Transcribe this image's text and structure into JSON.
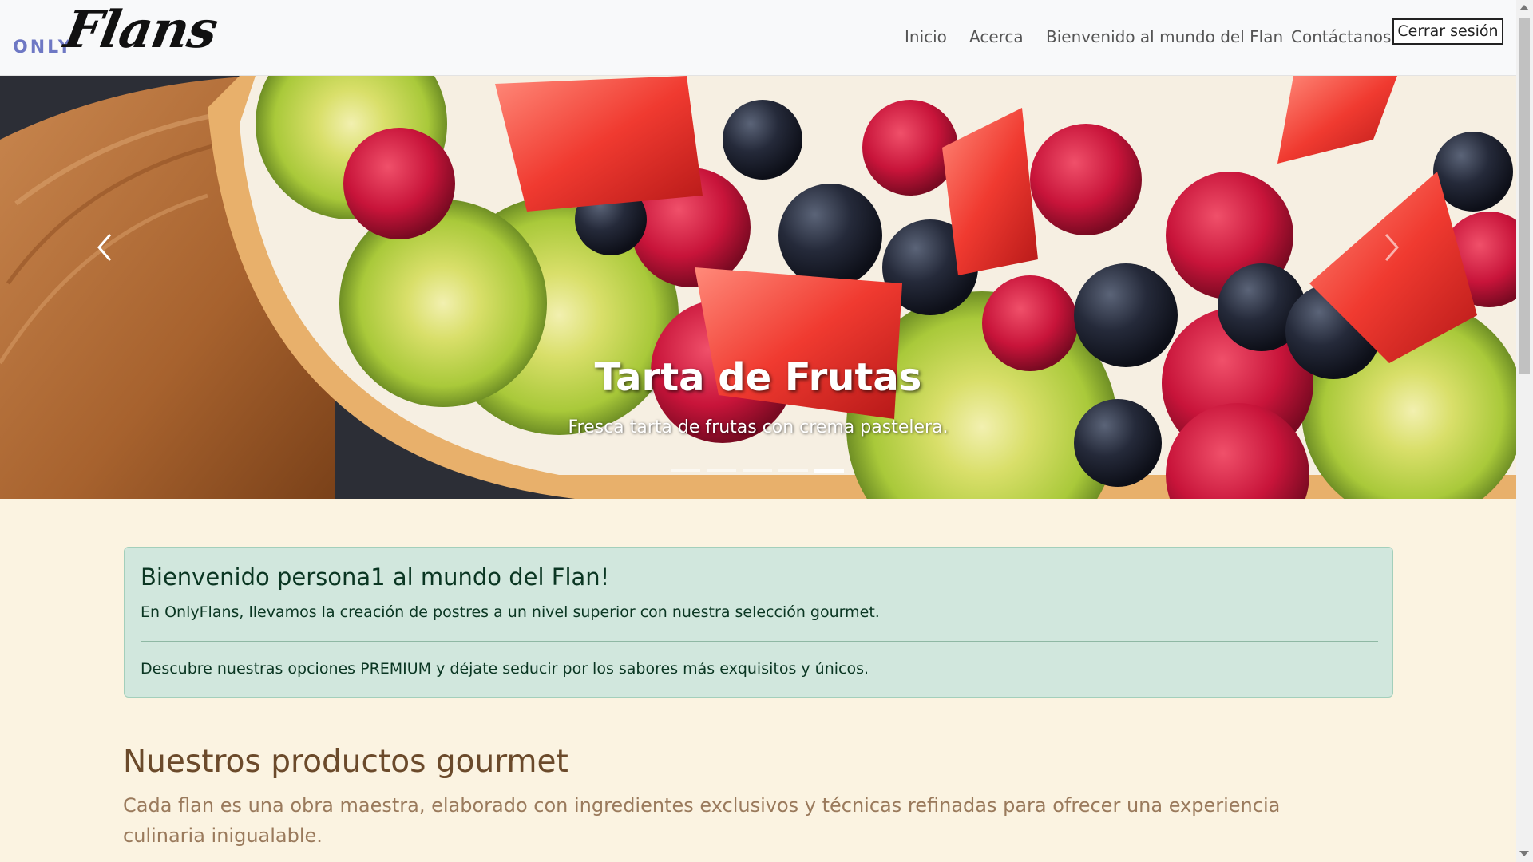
{
  "brand": {
    "logo_prefix": "ONLY",
    "logo_script": "Flans",
    "logo_color": "#6e78c4"
  },
  "nav": {
    "links": [
      "Inicio",
      "Acerca",
      "Bienvenido al mundo del Flan",
      "Contáctanos"
    ],
    "logout_label": "Cerrar sesión"
  },
  "carousel": {
    "title": "Tarta de Frutas",
    "subtitle": "Fresca tarta de frutas con crema pastelera.",
    "slide_count": 5,
    "active_index": 4,
    "prev_icon": "chevron-left-icon",
    "next_icon": "chevron-right-icon"
  },
  "welcome": {
    "title": "Bienvenido persona1 al mundo del Flan!",
    "text1": "En OnlyFlans, llevamos la creación de postres a un nivel superior con nuestra selección gourmet.",
    "text2": "Descubre nuestras opciones PREMIUM y déjate seducir por los sabores más exquisitos y únicos.",
    "bg_color": "#d1e7dd"
  },
  "products": {
    "title": "Nuestros productos gourmet",
    "lead": "Cada flan es una obra maestra, elaborado con ingredientes exclusivos y técnicas refinadas para ofrecer una experiencia culinaria inigualable."
  },
  "colors": {
    "page_bg": "#fbf3e1",
    "heading": "#6b4a2b",
    "lead_text": "#9a7a5c"
  }
}
